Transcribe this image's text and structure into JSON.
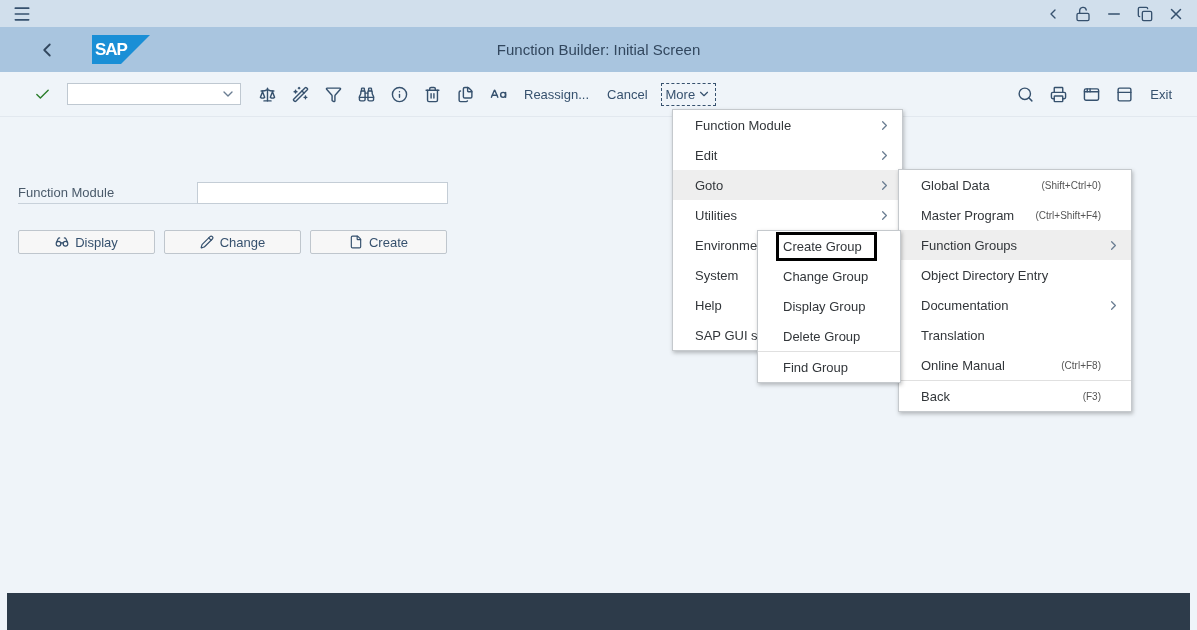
{
  "window": {
    "title": "Function Builder: Initial Screen",
    "logo_text": "SAP"
  },
  "toolbar": {
    "text_buttons": [
      {
        "label": "Reassign..."
      },
      {
        "label": "Cancel"
      }
    ],
    "more": {
      "label": "More",
      "focused": true
    },
    "exit": {
      "label": "Exit"
    }
  },
  "form": {
    "field_label": "Function Module",
    "buttons": [
      {
        "label": "Display",
        "kind": "display"
      },
      {
        "label": "Change",
        "kind": "change"
      },
      {
        "label": "Create",
        "kind": "create"
      }
    ]
  },
  "more_menu": {
    "items": [
      {
        "label": "Function Module",
        "has_submenu": true,
        "selected": false
      },
      {
        "label": "Edit",
        "has_submenu": true,
        "selected": false
      },
      {
        "label": "Goto",
        "has_submenu": true,
        "selected": true
      },
      {
        "label": "Utilities",
        "has_submenu": true,
        "selected": false
      },
      {
        "label": "Environme",
        "selected": false
      },
      {
        "label": "System",
        "selected": false
      },
      {
        "label": "Help",
        "selected": false
      },
      {
        "label": "SAP GUI s",
        "selected": false
      }
    ]
  },
  "goto_menu": {
    "items": [
      {
        "label": "Global Data",
        "shortcut": "(Shift+Ctrl+0)",
        "has_submenu": false,
        "selected": false,
        "separator_before": false
      },
      {
        "label": "Master Program",
        "shortcut": "(Ctrl+Shift+F4)",
        "has_submenu": false,
        "selected": false,
        "separator_before": false
      },
      {
        "label": "Function Groups",
        "has_submenu": true,
        "selected": true,
        "separator_before": false
      },
      {
        "label": "Object Directory Entry",
        "has_submenu": false,
        "selected": false,
        "separator_before": false
      },
      {
        "label": "Documentation",
        "has_submenu": true,
        "selected": false,
        "separator_before": false
      },
      {
        "label": "Translation",
        "has_submenu": false,
        "selected": false,
        "separator_before": false
      },
      {
        "label": "Online Manual",
        "shortcut": "(Ctrl+F8)",
        "has_submenu": false,
        "selected": false,
        "separator_before": false
      },
      {
        "label": "Back",
        "shortcut": "(F3)",
        "has_submenu": false,
        "selected": false,
        "separator_before": true
      }
    ]
  },
  "function_groups_menu": {
    "items": [
      {
        "label": "Create Group",
        "outlined": true,
        "separator_before": false
      },
      {
        "label": "Change Group",
        "outlined": false,
        "separator_before": false
      },
      {
        "label": "Display Group",
        "outlined": false,
        "separator_before": false
      },
      {
        "label": "Delete Group",
        "outlined": false,
        "separator_before": false
      },
      {
        "label": "Find Group",
        "outlined": false,
        "separator_before": true
      }
    ]
  }
}
